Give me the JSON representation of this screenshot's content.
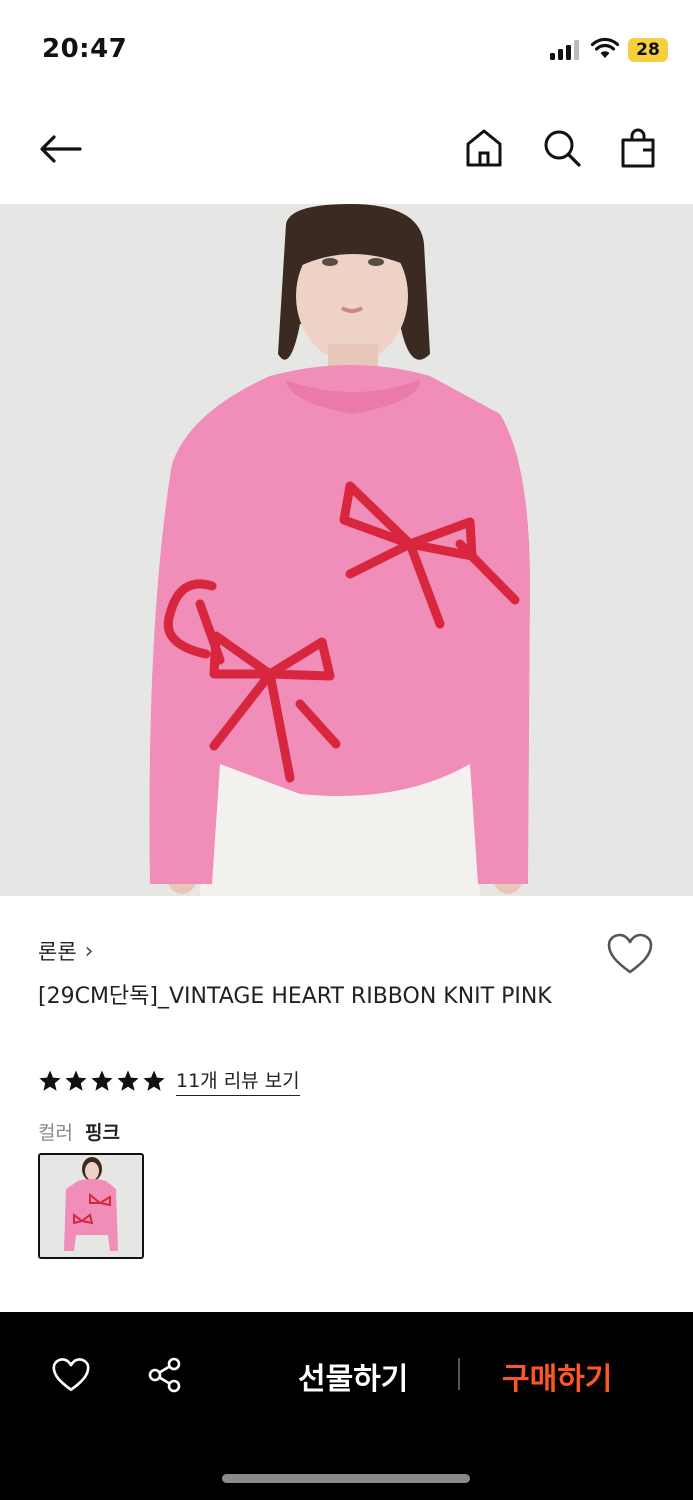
{
  "status": {
    "time": "20:47",
    "battery": "28"
  },
  "nav": {
    "back_icon": "arrow-left-icon",
    "home_icon": "home-icon",
    "search_icon": "search-icon",
    "bag_icon": "shopping-bag-icon"
  },
  "product": {
    "brand": "론론",
    "brand_chevron": "›",
    "name": "[29CM단독]_VINTAGE HEART RIBBON KNIT PINK",
    "rating_stars": 5,
    "review_link": "11개 리뷰 보기",
    "color_label": "컬러",
    "color_value": "핑크"
  },
  "bottom_bar": {
    "gift_label": "선물하기",
    "buy_label": "구매하기"
  },
  "colors": {
    "accent": "#ff5722",
    "sweater": "#f08db8",
    "ribbon": "#d7263d",
    "bar_bg": "#000000"
  }
}
